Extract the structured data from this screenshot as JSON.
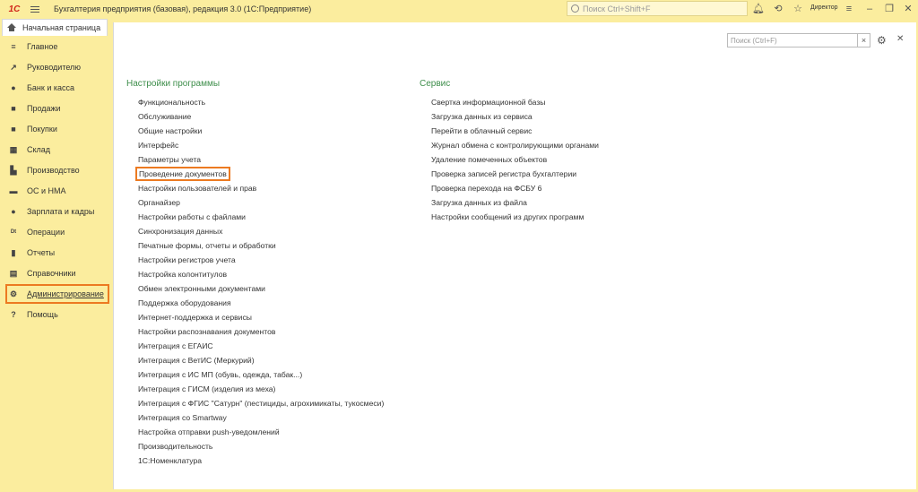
{
  "titlebar": {
    "logo_text": "1С",
    "app_title": "Бухгалтерия предприятия (базовая), редакция 3.0  (1С:Предприятие)",
    "search_placeholder": "Поиск Ctrl+Shift+F",
    "user_name": "Директор"
  },
  "tabs": {
    "home_label": "Начальная страница"
  },
  "sidebar": {
    "items": [
      {
        "label": "Главное",
        "icon": "≡"
      },
      {
        "label": "Руководителю",
        "icon": "↗"
      },
      {
        "label": "Банк и касса",
        "icon": "●"
      },
      {
        "label": "Продажи",
        "icon": "■"
      },
      {
        "label": "Покупки",
        "icon": "■"
      },
      {
        "label": "Склад",
        "icon": "▦"
      },
      {
        "label": "Производство",
        "icon": "▙"
      },
      {
        "label": "ОС и НМА",
        "icon": "▬"
      },
      {
        "label": "Зарплата и кадры",
        "icon": "●"
      },
      {
        "label": "Операции",
        "icon": "Dt"
      },
      {
        "label": "Отчеты",
        "icon": "▮"
      },
      {
        "label": "Справочники",
        "icon": "▤"
      },
      {
        "label": "Администрирование",
        "icon": "⚙"
      },
      {
        "label": "Помощь",
        "icon": "?"
      }
    ]
  },
  "main": {
    "search_placeholder": "Поиск (Ctrl+F)",
    "clear_label": "×",
    "settings_section": {
      "title": "Настройки программы",
      "items": [
        "Функциональность",
        "Обслуживание",
        "Общие настройки",
        "Интерфейс",
        "Параметры учета",
        "Проведение документов",
        "Настройки пользователей и прав",
        "Органайзер",
        "Настройки работы с файлами",
        "Синхронизация данных",
        "Печатные формы, отчеты и обработки",
        "Настройки регистров учета",
        "Настройка колонтитулов",
        "Обмен электронными документами",
        "Поддержка оборудования",
        "Интернет-поддержка и сервисы",
        "Настройки распознавания документов",
        "Интеграция с ЕГАИС",
        "Интеграция с ВетИС (Меркурий)",
        "Интеграция с ИС МП (обувь, одежда, табак...)",
        "Интеграция с ГИСМ (изделия из меха)",
        "Интеграция с ФГИС \"Сатурн\" (пестициды, агрохимикаты, тукосмеси)",
        "Интеграция со Smartway",
        "Настройка отправки push-уведомлений",
        "Производительность",
        "1С:Номенклатура"
      ]
    },
    "service_section": {
      "title": "Сервис",
      "items": [
        "Свертка информационной базы",
        "Загрузка данных из сервиса",
        "Перейти в облачный сервис",
        "Журнал обмена с контролирующими органами",
        "Удаление помеченных объектов",
        "Проверка записей регистра бухгалтерии",
        "Проверка перехода на ФСБУ 6",
        "Загрузка данных из файла",
        "Настройки сообщений из других программ"
      ]
    }
  },
  "colors": {
    "sidebar_bg": "#fbed9e",
    "section_title": "#3e8e4b",
    "highlight_border": "#ec7a21"
  }
}
